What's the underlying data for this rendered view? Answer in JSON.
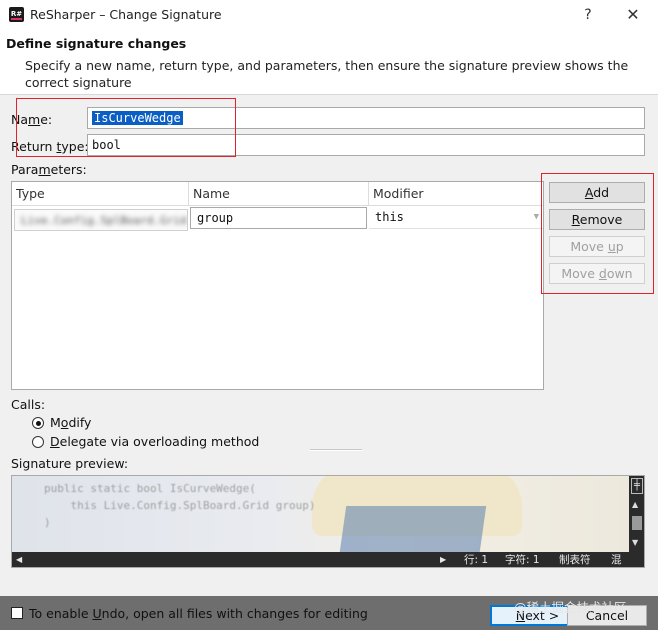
{
  "window": {
    "app_icon_text": "R#",
    "title": "ReSharper – Change Signature",
    "help_label": "?",
    "close_label": "✕"
  },
  "header": {
    "title": "Define signature changes",
    "description": "Specify a new name, return type, and parameters, then ensure the signature preview shows the correct signature"
  },
  "form": {
    "name_label": "Name:",
    "name_value": "IsCurveWedge",
    "return_type_label": "Return type:",
    "return_type_value": "bool",
    "parameters_label": "Parameters:"
  },
  "parameters": {
    "columns": [
      "Type",
      "Name",
      "Modifier"
    ],
    "rows": [
      {
        "type": "Live.Config.SplBoard.Grid",
        "name": "group",
        "modifier": "this"
      }
    ]
  },
  "buttons": {
    "add": "Add",
    "remove": "Remove",
    "move_up": "Move up",
    "move_down": "Move down"
  },
  "calls": {
    "label": "Calls:",
    "options": [
      {
        "label": "Modify",
        "checked": true
      },
      {
        "label": "Delegate via overloading method",
        "checked": false
      }
    ]
  },
  "preview": {
    "label": "Signature preview:",
    "code_line1": "public static bool IsCurveWedge(",
    "code_line2": "    this Live.Config.SplBoard.Grid group)",
    "code_line3": ")",
    "status_row": "行: 1",
    "status_col": "字符: 1",
    "status_tab": "制表符",
    "status_mode": "混合",
    "scroll_up": "▲",
    "scroll_down": "▼",
    "scroll_left": "◀",
    "scroll_right": "▶"
  },
  "footer": {
    "undo_text": "To enable Undo, open all files with changes for editing",
    "next": "Next >",
    "cancel": "Cancel",
    "watermark": "@稀土掘金技术社区"
  },
  "colors": {
    "annotation_red": "#e0222a",
    "selection_blue": "#0a5fc4",
    "dialog_bg": "#f0f0f0"
  }
}
